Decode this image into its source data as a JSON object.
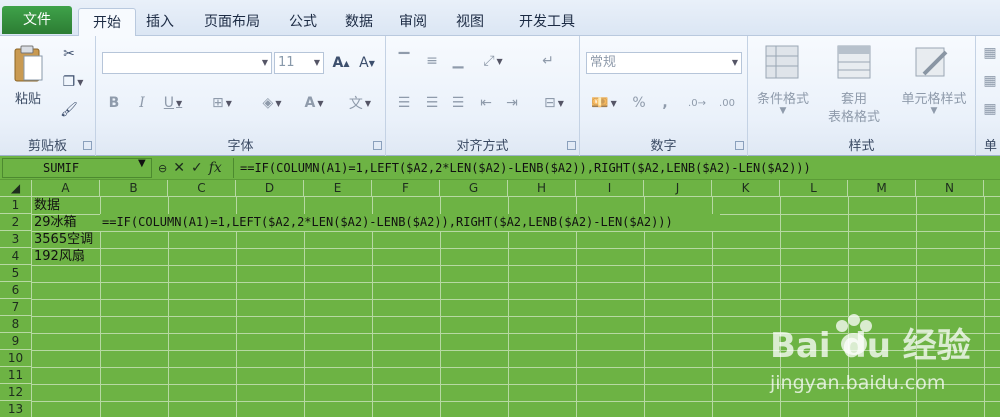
{
  "tabs": [
    "文件",
    "开始",
    "插入",
    "页面布局",
    "公式",
    "数据",
    "审阅",
    "视图",
    "开发工具"
  ],
  "ribbon": {
    "clipboard": {
      "paste_label": "粘贴",
      "group_label": "剪贴板"
    },
    "font": {
      "font_size": "11",
      "bold": "B",
      "italic": "I",
      "underline": "U",
      "group_label": "字体",
      "grow_icon": "font-grow-icon",
      "shrink_icon": "font-shrink-icon"
    },
    "alignment": {
      "group_label": "对齐方式"
    },
    "number": {
      "format_value": "常规",
      "percent": "%",
      "comma": ",",
      "group_label": "数字"
    },
    "styles": {
      "conditional": "条件格式",
      "table_style_line1": "套用",
      "table_style_line2": "表格格式",
      "cell_styles": "单元格样式",
      "group_label": "样式"
    },
    "cells": {
      "group_label": "单"
    }
  },
  "formula_bar": {
    "name_box": "SUMIF",
    "cancel": "✕",
    "enter": "✓",
    "fx": "fx",
    "formula": "==IF(COLUMN(A1)=1,LEFT($A2,2*LEN($A2)-LENB($A2)),RIGHT($A2,LENB($A2)-LEN($A2)))"
  },
  "sheet": {
    "columns": [
      "A",
      "B",
      "C",
      "D",
      "E",
      "F",
      "G",
      "H",
      "I",
      "J",
      "K",
      "L",
      "M",
      "N"
    ],
    "rows": [
      "1",
      "2",
      "3",
      "4",
      "5",
      "6",
      "7",
      "8",
      "9",
      "10",
      "11",
      "12",
      "13"
    ],
    "cells": {
      "A1": "数据",
      "A2": "29冰箱",
      "A3": "3565空调",
      "A4": "192风扇",
      "B2": "==IF(COLUMN(A1)=1,LEFT($A2,2*LEN($A2)-LENB($A2)),RIGHT($A2,LENB($A2)-LEN($A2)))"
    }
  },
  "watermark": {
    "logo": "Bai  du 经验",
    "url": "jingyan.baidu.com"
  }
}
